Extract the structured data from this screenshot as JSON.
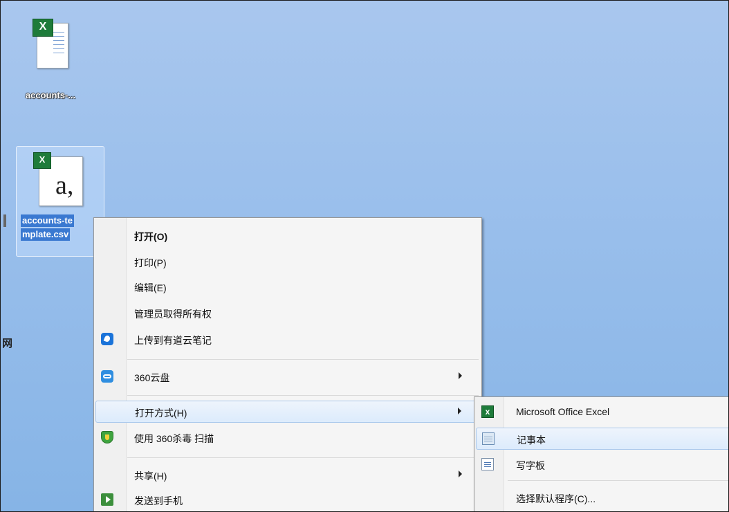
{
  "desktop": {
    "icons": [
      {
        "label": "accounts-..."
      },
      {
        "label_line1": "accounts-te",
        "label_line2": "mplate.csv"
      }
    ],
    "edge_char": "网"
  },
  "context_menu": {
    "items": [
      {
        "label": "打开(O)"
      },
      {
        "label": "打印(P)"
      },
      {
        "label": "编辑(E)"
      },
      {
        "label": "管理员取得所有权"
      },
      {
        "label": "上传到有道云笔记",
        "icon": "youdao-note-icon"
      },
      {
        "label": "360云盘",
        "icon": "360-cloud-icon"
      },
      {
        "label": "打开方式(H)"
      },
      {
        "label": "使用 360杀毒 扫描",
        "icon": "360-antivirus-shield-icon"
      },
      {
        "label": "共享(H)"
      },
      {
        "label": "发送到手机",
        "icon": "send-to-phone-icon"
      }
    ]
  },
  "open_with_menu": {
    "items": [
      {
        "label": "Microsoft Office Excel",
        "icon": "excel-icon"
      },
      {
        "label": "记事本",
        "icon": "notepad-icon"
      },
      {
        "label": "写字板",
        "icon": "wordpad-icon"
      },
      {
        "label": "选择默认程序(C)..."
      }
    ]
  },
  "colors": {
    "desktop_bg": "#9cc0ec",
    "menu_bg": "#f5f5f5",
    "highlight_border": "#a9c8ec",
    "selection_label_bg": "#3a79d1"
  }
}
